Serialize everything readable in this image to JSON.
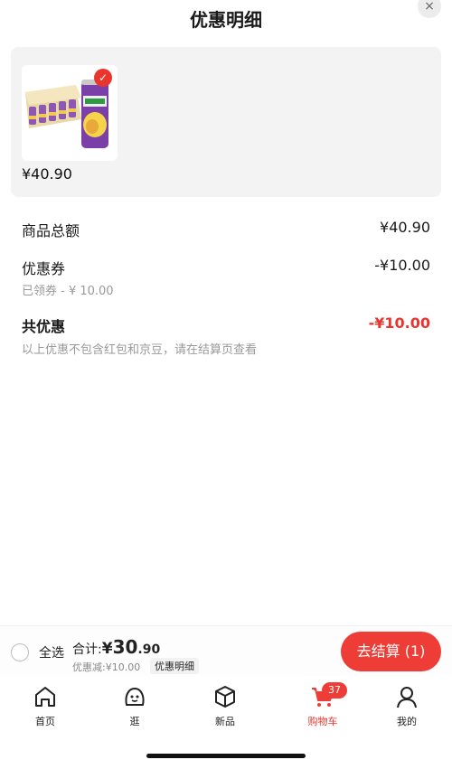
{
  "header": {
    "title": "优惠明细",
    "close_symbol": "×"
  },
  "product": {
    "price": "¥40.90",
    "check_symbol": "✓",
    "image": "beverage-cans-pack"
  },
  "summary": {
    "goods_total_label": "商品总额",
    "goods_total_value": "¥40.90",
    "coupon_label": "优惠券",
    "coupon_value": "-¥10.00",
    "coupon_sub": "已领券 - ¥ 10.00",
    "total_discount_label": "共优惠",
    "total_discount_value": "-¥10.00",
    "note": "以上优惠不包含红包和京豆，请在结算页查看"
  },
  "checkout": {
    "select_all_label": "全选",
    "sum_label": "合计:",
    "sum_currency": "¥",
    "sum_int": "30",
    "sum_dec": ".90",
    "discount_text": "优惠减:¥10.00",
    "detail_link": "优惠明细",
    "checkout_button": "去结算 (1)"
  },
  "tabs": [
    {
      "label": "首页",
      "icon": "home-icon"
    },
    {
      "label": "逛",
      "icon": "explore-face-icon"
    },
    {
      "label": "新品",
      "icon": "cube-icon"
    },
    {
      "label": "购物车",
      "icon": "cart-icon",
      "badge": "37"
    },
    {
      "label": "我的",
      "icon": "person-icon"
    }
  ],
  "colors": {
    "accent": "#ee3d37",
    "card_bg": "#f3f3f3",
    "muted_text": "#999999"
  }
}
